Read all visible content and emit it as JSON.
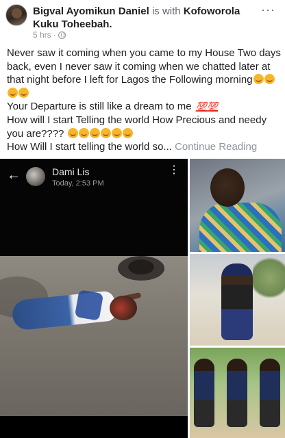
{
  "post": {
    "author": "Bigval Ayomikun Daniel",
    "with_text": "is with",
    "tagged": "Kofoworola Kuku Toheebah.",
    "time": "5 hrs",
    "dot": "·",
    "more": "···",
    "para1": "Never saw  it coming when you came to my House Two days back, even I never saw it coming when we chatted later at that night before I left for Lagos the Following morning",
    "para2": "Your Departure is still like a dream to me",
    "hundred": "💯💯",
    "para3": "How will I start Telling the world How Precious and needy you are????",
    "para4": "How Will I start telling the world so...",
    "continue": "Continue Reading"
  },
  "photo_main": {
    "back": "←",
    "name": "Dami Lis",
    "time": "Today, 2:53 PM",
    "kebab": "⋮"
  },
  "icons": [
    "globe-icon",
    "more-icon",
    "back-arrow-icon",
    "kebab-menu-icon",
    "crying-emoji-icon",
    "hundred-emoji-icon",
    "hugging-emoji-icon"
  ],
  "colors": {
    "text": "#1c1e21",
    "meta": "#90949c",
    "link": "#90949c",
    "dark_photo_bg": "#050505"
  }
}
